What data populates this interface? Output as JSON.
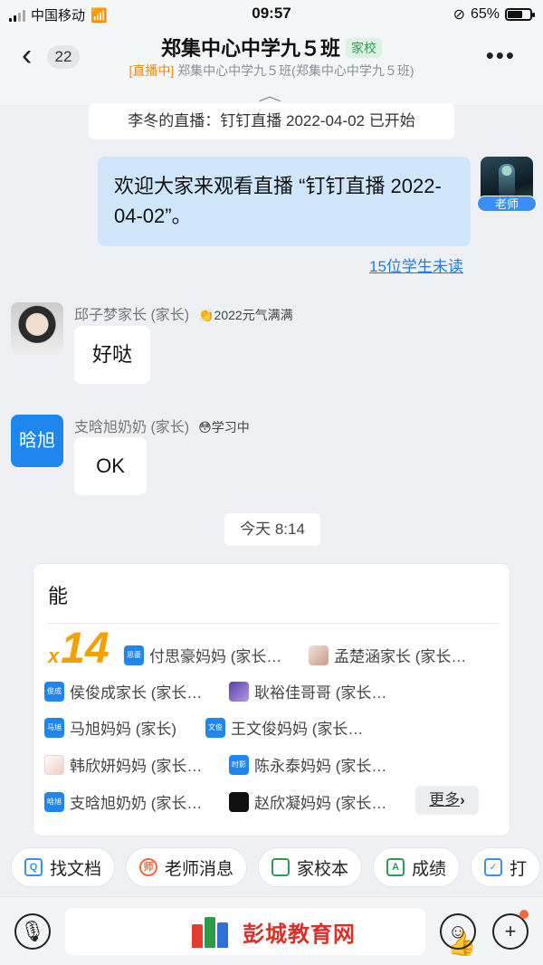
{
  "status_bar": {
    "carrier": "中国移动",
    "time": "09:57",
    "battery": "65%",
    "battery_level": 0.65
  },
  "nav": {
    "back_count": "22",
    "title": "郑集中心中学九５班",
    "tag": "家校",
    "live_label": "[直播中]",
    "subtitle": "郑集中心中学九５班(郑集中心中学九５班)"
  },
  "messages": {
    "system": "李冬的直播：钉钉直播 2022-04-02 已开始",
    "teacher": {
      "text": "欢迎大家来观看直播 “钉钉直播 2022-04-02”。",
      "role_tag": "老师",
      "unread": "15位学生未读"
    },
    "msg1": {
      "sender": "邱子梦家长 (家长)",
      "badge": "👏2022元气满满",
      "text": "好哒"
    },
    "msg2": {
      "sender": "支晗旭奶奶 (家长)",
      "badge": "😳学习中",
      "avatar_text": "晗旭",
      "text": "OK"
    },
    "time": "今天 8:14"
  },
  "card": {
    "title": "能",
    "count_prefix": "x",
    "count": "14",
    "people": [
      {
        "name": "付思豪妈妈 (家长…",
        "avatar": "思豪"
      },
      {
        "name": "孟楚涵家长 (家长…",
        "avatar": ""
      },
      {
        "name": "侯俊成家长 (家长…",
        "avatar": "俊成"
      },
      {
        "name": "耿裕佳哥哥 (家长…",
        "avatar": ""
      },
      {
        "name": "马旭妈妈 (家长)",
        "avatar": "马旭"
      },
      {
        "name": "王文俊妈妈 (家长…",
        "avatar": "文俊"
      },
      {
        "name": "韩欣妍妈妈 (家长…",
        "avatar": ""
      },
      {
        "name": "陈永泰妈妈 (家长…",
        "avatar": "时影"
      },
      {
        "name": "支晗旭奶奶 (家长…",
        "avatar": "晗旭"
      },
      {
        "name": "赵欣凝妈妈 (家长…",
        "avatar": ""
      }
    ],
    "more": "更多",
    "more_arrow": "›"
  },
  "actions": [
    {
      "label": "找文档",
      "icon": "search-doc-icon",
      "color": "#3c8ef7",
      "glyph": "Q"
    },
    {
      "label": "老师消息",
      "icon": "teacher-message-icon",
      "color": "#f26a3a",
      "glyph": "师"
    },
    {
      "label": "家校本",
      "icon": "notebook-icon",
      "color": "#2f9a55",
      "glyph": ""
    },
    {
      "label": "成绩",
      "icon": "grades-icon",
      "color": "#2f9a55",
      "glyph": "A"
    },
    {
      "label": "打",
      "icon": "calendar-icon",
      "color": "#3c8ef7",
      "glyph": "✓"
    }
  ],
  "watermark": "彭城教育网"
}
